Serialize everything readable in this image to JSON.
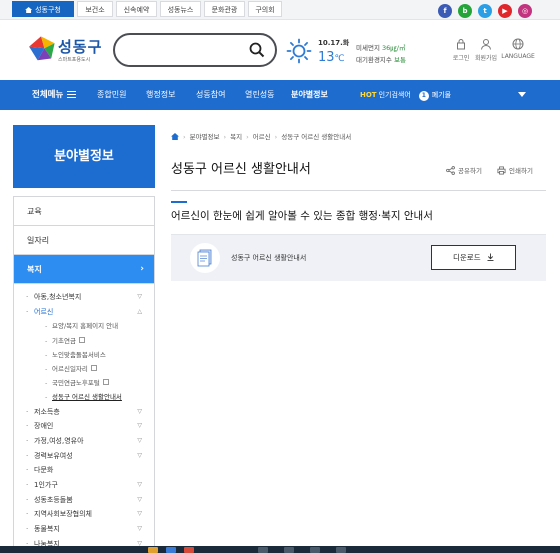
{
  "top_tabs": [
    {
      "label": "성동구청",
      "active": true
    },
    {
      "label": "보건소",
      "active": false
    },
    {
      "label": "신속예약",
      "active": false
    },
    {
      "label": "성동뉴스",
      "active": false
    },
    {
      "label": "문화관광",
      "active": false
    },
    {
      "label": "구의회",
      "active": false
    }
  ],
  "social": [
    {
      "icon": "facebook-icon",
      "glyph": "f",
      "color": "#3b5bb5"
    },
    {
      "icon": "blog-icon",
      "glyph": "b",
      "color": "#25a43a"
    },
    {
      "icon": "twitter-icon",
      "glyph": "t",
      "color": "#2b9fe6"
    },
    {
      "icon": "youtube-icon",
      "glyph": "▶",
      "color": "#e0262b"
    },
    {
      "icon": "instagram-icon",
      "glyph": "◎",
      "color": "#c2347f"
    }
  ],
  "header": {
    "logo_name": "성동구",
    "logo_sub": "스마트포용도시",
    "search_placeholder": "",
    "weather": {
      "date": "10.17.화",
      "temp": "13",
      "unit": "℃",
      "dust_label": "미세먼지",
      "dust_value": "36㎍/㎥",
      "air_label": "대기환경지수",
      "air_value": "보통"
    },
    "util": [
      {
        "label": "로그인",
        "icon": "lock-icon"
      },
      {
        "label": "회원가입",
        "icon": "user-icon"
      },
      {
        "label": "LANGUAGE",
        "icon": "globe-icon"
      }
    ]
  },
  "nav": {
    "all_menu": "전체메뉴",
    "items": [
      "종합민원",
      "행정정보",
      "성동참여",
      "열린성동",
      "분야별정보"
    ],
    "active_index": 4,
    "hot_tag": "HOT",
    "hot_label": "인기검색어",
    "hot_rank": "1",
    "hot_keyword": "폐기물"
  },
  "sidebar": {
    "title": "분야별정보",
    "items": [
      "교육",
      "일자리",
      "복지"
    ],
    "active_item": "복지",
    "subs_before": [
      {
        "label": "아동,청소년복지",
        "chev": "▽"
      },
      {
        "label": "어르신",
        "chev": "△",
        "open": true
      }
    ],
    "sub3": [
      {
        "label": "요양/복지 홈페이지 안내",
        "ext": false
      },
      {
        "label": "기초연금",
        "ext": true
      },
      {
        "label": "노인맞춤돌봄서비스",
        "ext": false
      },
      {
        "label": "어르신일자리",
        "ext": true
      },
      {
        "label": "국민연금노후포털",
        "ext": true
      },
      {
        "label": "성동구 어르신 생활안내서",
        "ext": false,
        "current": true
      }
    ],
    "subs_after": [
      {
        "label": "저소득층",
        "chev": "▽"
      },
      {
        "label": "장애인",
        "chev": "▽"
      },
      {
        "label": "가정,여성,영유아",
        "chev": "▽"
      },
      {
        "label": "경력보유여성",
        "chev": "▽"
      },
      {
        "label": "다문화",
        "chev": ""
      },
      {
        "label": "1인가구",
        "chev": "▽"
      },
      {
        "label": "성동초등돌봄",
        "chev": "▽"
      },
      {
        "label": "지역사회보장협의체",
        "chev": "▽"
      },
      {
        "label": "동물복지",
        "chev": "▽"
      },
      {
        "label": "나눔복지",
        "chev": "▽"
      }
    ]
  },
  "breadcrumb": [
    "분야별정보",
    "복지",
    "어르신",
    "성동구 어르신 생활안내서"
  ],
  "content": {
    "title": "성동구 어르신 생활안내서",
    "share_label": "공유하기",
    "print_label": "인쇄하기",
    "subtitle": "어르신이 한눈에 쉽게 알아볼 수 있는 종합 행정·복지 안내서",
    "file_name": "성동구 어르신 생활안내서",
    "download_label": "디운로드"
  }
}
